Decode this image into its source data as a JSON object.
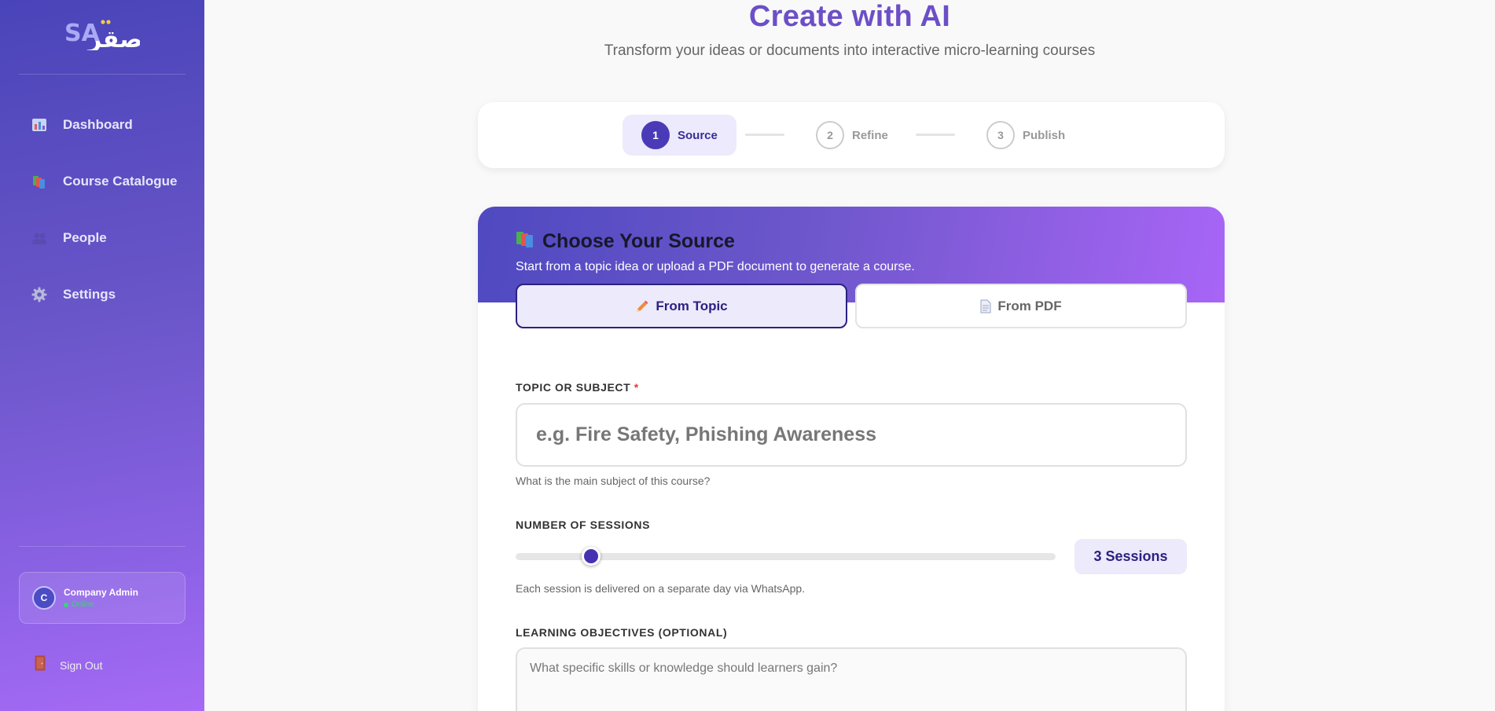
{
  "colors": {
    "accent": "#6c4fc7",
    "primary_dark": "#2b2180",
    "required": "#e23b3b",
    "online": "#3dd17a"
  },
  "sidebar": {
    "logo": {
      "latin_text": "SA",
      "arabic_text": "صقر"
    },
    "items": [
      {
        "label": "Dashboard",
        "icon": "dashboard-icon"
      },
      {
        "label": "Course Catalogue",
        "icon": "books-icon"
      },
      {
        "label": "People",
        "icon": "people-icon"
      },
      {
        "label": "Settings",
        "icon": "gear-icon"
      }
    ],
    "user": {
      "initial": "C",
      "name": "Company Admin",
      "status": "Online"
    },
    "signout_label": "Sign Out"
  },
  "main": {
    "title": "Create with AI",
    "subtitle": "Transform your ideas or documents into interactive micro-learning courses",
    "stepper": {
      "current_step": 1,
      "steps": [
        {
          "number": "1",
          "label": "Source"
        },
        {
          "number": "2",
          "label": "Refine"
        },
        {
          "number": "3",
          "label": "Publish"
        }
      ]
    },
    "source_card": {
      "title": "Choose Your Source",
      "description": "Start from a topic idea or upload a PDF document to generate a course.",
      "selected_tab": "From Topic",
      "tabs": [
        {
          "label": "From Topic",
          "icon": "pencil-icon"
        },
        {
          "label": "From PDF",
          "icon": "document-icon"
        }
      ],
      "topic": {
        "label": "TOPIC OR SUBJECT",
        "required_mark": "*",
        "placeholder": "e.g. Fire Safety, Phishing Awareness",
        "value": "",
        "hint": "What is the main subject of this course?"
      },
      "sessions": {
        "label": "NUMBER OF SESSIONS",
        "value": 3,
        "slider_fraction": 0.14,
        "badge": "3 Sessions",
        "hint": "Each session is delivered on a separate day via WhatsApp."
      },
      "objectives": {
        "label": "LEARNING OBJECTIVES (OPTIONAL)",
        "placeholder": "What specific skills or knowledge should learners gain?",
        "value": ""
      }
    }
  }
}
